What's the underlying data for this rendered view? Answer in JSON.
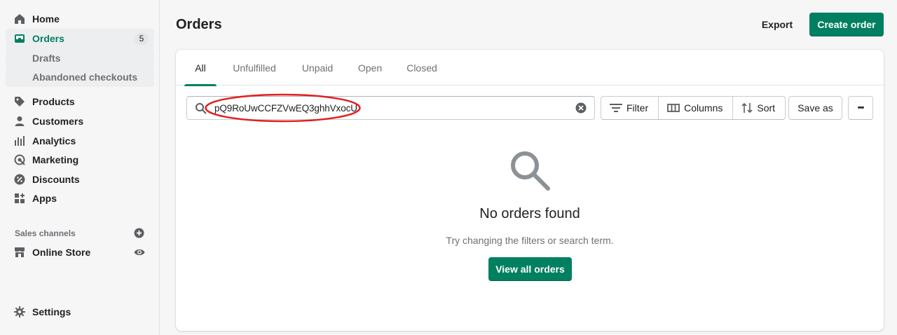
{
  "sidebar": {
    "items": [
      {
        "label": "Home",
        "icon": "home-icon"
      },
      {
        "label": "Orders",
        "icon": "orders-icon",
        "badge": "5"
      },
      {
        "label": "Drafts"
      },
      {
        "label": "Abandoned checkouts"
      },
      {
        "label": "Products",
        "icon": "tag-icon"
      },
      {
        "label": "Customers",
        "icon": "person-icon"
      },
      {
        "label": "Analytics",
        "icon": "bar-chart-icon"
      },
      {
        "label": "Marketing",
        "icon": "target-icon"
      },
      {
        "label": "Discounts",
        "icon": "discount-icon"
      },
      {
        "label": "Apps",
        "icon": "apps-icon"
      }
    ],
    "sales_channels_label": "Sales channels",
    "online_store_label": "Online Store",
    "settings_label": "Settings"
  },
  "header": {
    "title": "Orders",
    "export_label": "Export",
    "create_label": "Create order"
  },
  "tabs": [
    "All",
    "Unfulfilled",
    "Unpaid",
    "Open",
    "Closed"
  ],
  "search": {
    "value": "pQ9RoUwCCFZVwEQ3ghhVxocU"
  },
  "toolbar": {
    "filter_label": "Filter",
    "columns_label": "Columns",
    "sort_label": "Sort",
    "save_as_label": "Save as",
    "more_label": "•••"
  },
  "empty_state": {
    "title": "No orders found",
    "subtitle": "Try changing the filters or search term.",
    "button_label": "View all orders"
  },
  "colors": {
    "accent": "#008060",
    "annotation": "#e02020"
  }
}
